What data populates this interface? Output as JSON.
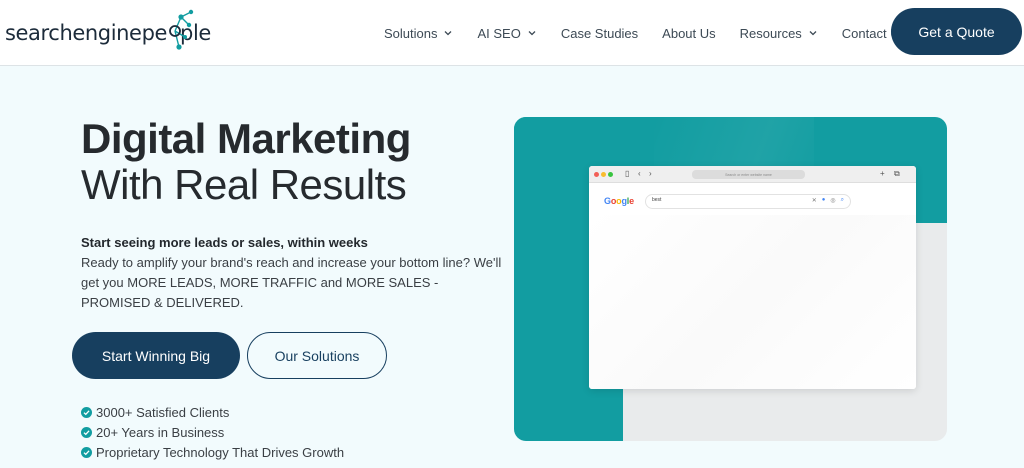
{
  "header": {
    "logo": {
      "part1": "searchengine",
      "part2": "pe",
      "part3": "ple"
    },
    "nav": [
      {
        "label": "Solutions",
        "has_dropdown": true
      },
      {
        "label": "AI SEO",
        "has_dropdown": true
      },
      {
        "label": "Case Studies",
        "has_dropdown": false
      },
      {
        "label": "About Us",
        "has_dropdown": false
      },
      {
        "label": "Resources",
        "has_dropdown": true
      },
      {
        "label": "Contact Us",
        "has_dropdown": false
      }
    ],
    "cta_label": "Get a Quote"
  },
  "hero": {
    "title_line1": "Digital Marketing",
    "title_line2": "With Real Results",
    "lead": "Start seeing more leads or sales, within weeks",
    "body": "Ready to amplify your brand's reach and increase your bottom line? We'll get you MORE LEADS, MORE TRAFFIC and MORE SALES - PROMISED & DELIVERED.",
    "primary_button": "Start Winning Big",
    "secondary_button": "Our Solutions",
    "checks": [
      "3000+ Satisfied Clients",
      "20+ Years in Business",
      "Proprietary Technology That Drives Growth"
    ]
  },
  "browser": {
    "url_placeholder": "Search or enter website name",
    "search_value": "best"
  },
  "colors": {
    "navy": "#173f5f",
    "teal": "#129da1",
    "check_teal": "#129da1",
    "background": "#f2fbfd"
  }
}
